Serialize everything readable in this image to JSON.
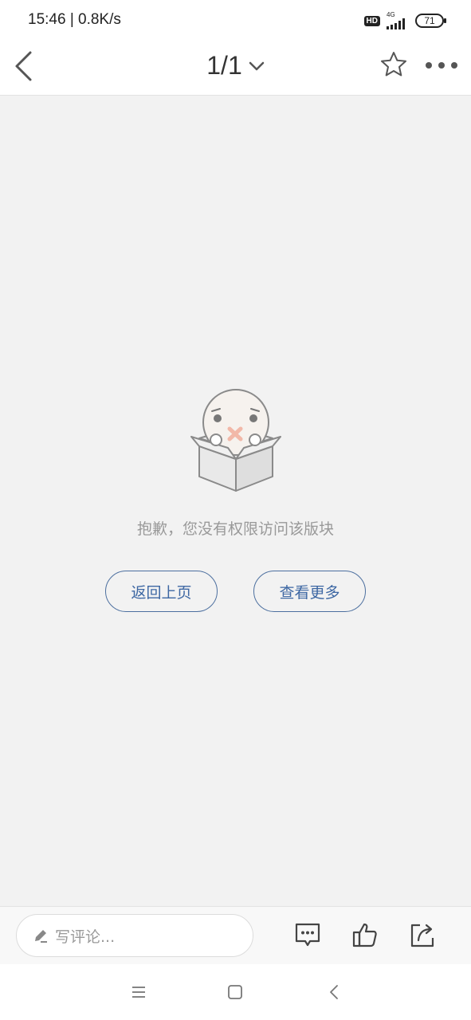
{
  "status_bar": {
    "time_speed": "15:46 | 0.8K/s",
    "hd_badge": "HD",
    "network": "4G",
    "battery": "71"
  },
  "nav": {
    "page_indicator": "1/1",
    "icons": [
      "back-arrow-icon",
      "chevron-down-icon",
      "star-icon",
      "more-icon"
    ]
  },
  "empty_state": {
    "message": "抱歉，您没有权限访问该版块",
    "back_button": "返回上页",
    "more_button": "查看更多"
  },
  "bottom_bar": {
    "comment_placeholder": "写评论...",
    "icons": [
      "pencil-icon",
      "comment-icon",
      "thumbs-up-icon",
      "share-icon"
    ]
  },
  "system_nav": {
    "icons": [
      "menu-icon",
      "home-icon",
      "back-icon"
    ]
  },
  "colors": {
    "page_background": "#f2f2f2",
    "accent": "#3d67a3",
    "message_text": "#999999"
  }
}
